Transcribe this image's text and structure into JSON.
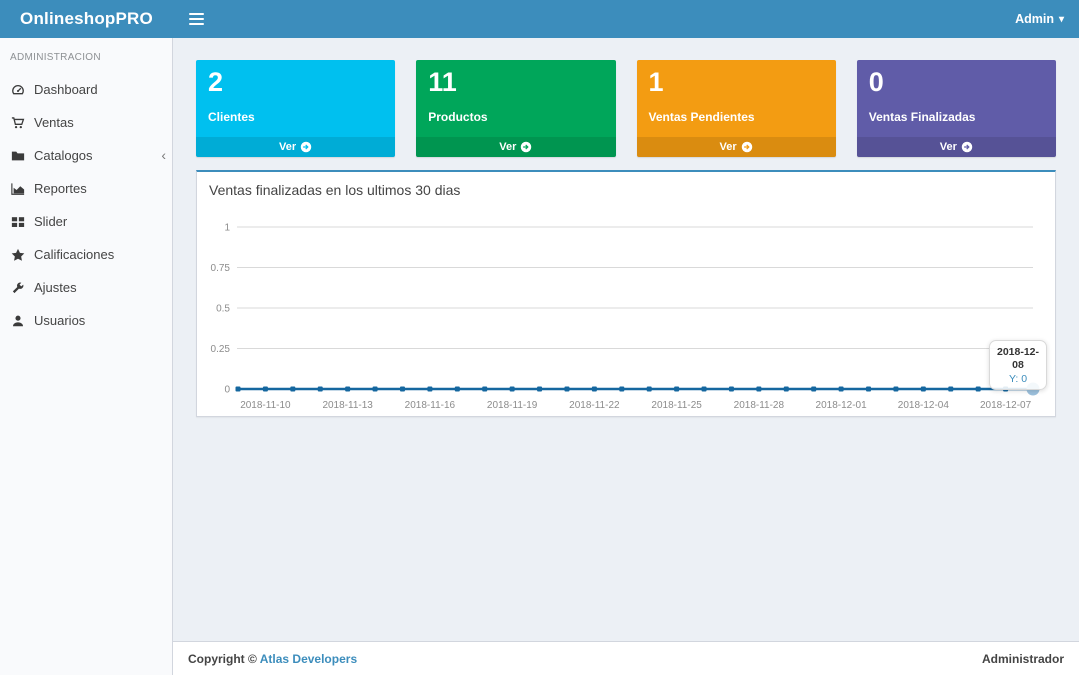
{
  "header": {
    "brand": "OnlineshopPRO",
    "user_menu_label": "Admin"
  },
  "sidebar": {
    "section_label": "ADMINISTRACION",
    "items": [
      {
        "label": "Dashboard",
        "icon": "dashboard-icon"
      },
      {
        "label": "Ventas",
        "icon": "cart-icon"
      },
      {
        "label": "Catalogos",
        "icon": "folder-icon",
        "has_submenu": true
      },
      {
        "label": "Reportes",
        "icon": "area-chart-icon"
      },
      {
        "label": "Slider",
        "icon": "grid-icon"
      },
      {
        "label": "Calificaciones",
        "icon": "star-icon"
      },
      {
        "label": "Ajustes",
        "icon": "wrench-icon"
      },
      {
        "label": "Usuarios",
        "icon": "user-icon"
      }
    ]
  },
  "cards": [
    {
      "value": "2",
      "label": "Clientes",
      "link_label": "Ver",
      "color": "#00c0ef"
    },
    {
      "value": "11",
      "label": "Productos",
      "link_label": "Ver",
      "color": "#00a65a"
    },
    {
      "value": "1",
      "label": "Ventas Pendientes",
      "link_label": "Ver",
      "color": "#f39c12"
    },
    {
      "value": "0",
      "label": "Ventas Finalizadas",
      "link_label": "Ver",
      "color": "#605ca8"
    }
  ],
  "chart_panel": {
    "title": "Ventas finalizadas en los ultimos 30 dias"
  },
  "chart_data": {
    "type": "line",
    "title": "Ventas finalizadas en los ultimos 30 dias",
    "x": [
      "2018-11-09",
      "2018-11-10",
      "2018-11-11",
      "2018-11-12",
      "2018-11-13",
      "2018-11-14",
      "2018-11-15",
      "2018-11-16",
      "2018-11-17",
      "2018-11-18",
      "2018-11-19",
      "2018-11-20",
      "2018-11-21",
      "2018-11-22",
      "2018-11-23",
      "2018-11-24",
      "2018-11-25",
      "2018-11-26",
      "2018-11-27",
      "2018-11-28",
      "2018-11-29",
      "2018-11-30",
      "2018-12-01",
      "2018-12-02",
      "2018-12-03",
      "2018-12-04",
      "2018-12-05",
      "2018-12-06",
      "2018-12-07",
      "2018-12-08"
    ],
    "values": [
      0,
      0,
      0,
      0,
      0,
      0,
      0,
      0,
      0,
      0,
      0,
      0,
      0,
      0,
      0,
      0,
      0,
      0,
      0,
      0,
      0,
      0,
      0,
      0,
      0,
      0,
      0,
      0,
      0,
      0
    ],
    "ylim": [
      0,
      1
    ],
    "yticks": [
      0,
      0.25,
      0.5,
      0.75,
      1
    ],
    "ytick_labels": [
      "0",
      "0.25",
      "0.5",
      "0.75",
      "1"
    ],
    "xtick_labels": [
      "2018-11-10",
      "2018-11-13",
      "2018-11-16",
      "2018-11-19",
      "2018-11-22",
      "2018-11-25",
      "2018-11-28",
      "2018-12-01",
      "2018-12-04",
      "2018-12-07"
    ],
    "xtick_indices": [
      1,
      4,
      7,
      10,
      13,
      16,
      19,
      22,
      25,
      28
    ],
    "grid": true,
    "legend": false,
    "line_color": "#15679f",
    "grid_color": "#d9d9d9",
    "tick_color": "#8c8c8c",
    "hover_point_color": "#9cc0dc",
    "hover": {
      "index": 29,
      "x": "2018-12-08",
      "y": 0
    }
  },
  "tooltip": {
    "date": "2018-12-08",
    "value_label": "Y: 0"
  },
  "footer": {
    "copyright_prefix": "Copyright © ",
    "link_label": "Atlas Developers",
    "right_label": "Administrador"
  }
}
